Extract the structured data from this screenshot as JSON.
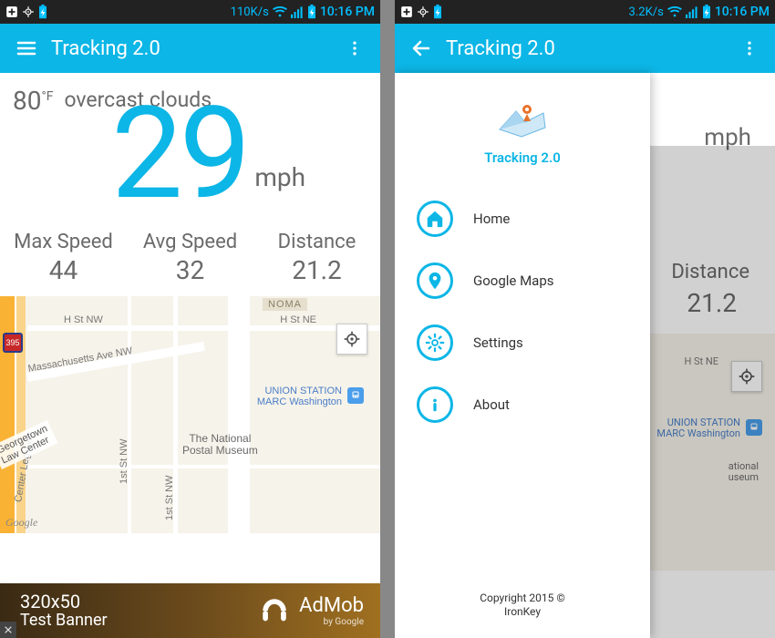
{
  "colors": {
    "primary": "#0cb6e6",
    "muted": "#6a6a6a"
  },
  "status": {
    "left_time": "10:16 PM",
    "left_rate": "110K/s",
    "right_time": "10:16 PM",
    "right_rate": "3.2K/s"
  },
  "appbar": {
    "title": "Tracking 2.0"
  },
  "dashboard": {
    "temp_value": "80",
    "temp_unit": "°F",
    "weather_desc": "overcast clouds",
    "speed_value": "29",
    "speed_unit": "mph",
    "stats": [
      {
        "label": "Max Speed",
        "value": "44"
      },
      {
        "label": "Avg Speed",
        "value": "32"
      },
      {
        "label": "Distance",
        "value": "21.2"
      }
    ]
  },
  "map": {
    "noma": "NOMA",
    "h_nw": "H St NW",
    "h_ne": "H St NE",
    "mass": "Massachusetts Ave NW",
    "first_sw": "1st St NW",
    "first": "1st St NW",
    "leg": "Center Leg Fwy",
    "i395": "395",
    "museum": "The National\nPostal Museum",
    "gtown": "Georgetown\nLaw Center",
    "transit": "UNION STATION\nMARC Washington",
    "google": "Google"
  },
  "ad": {
    "size": "320x50",
    "label": "Test Banner",
    "brand": "AdMob",
    "brand_sub": "by Google"
  },
  "drawer": {
    "name": "Tracking 2.0",
    "items": [
      {
        "id": "home",
        "label": "Home"
      },
      {
        "id": "maps",
        "label": "Google Maps"
      },
      {
        "id": "settings",
        "label": "Settings"
      },
      {
        "id": "about",
        "label": "About"
      }
    ],
    "footer_line1": "Copyright 2015 ©",
    "footer_line2": "IronKey"
  }
}
